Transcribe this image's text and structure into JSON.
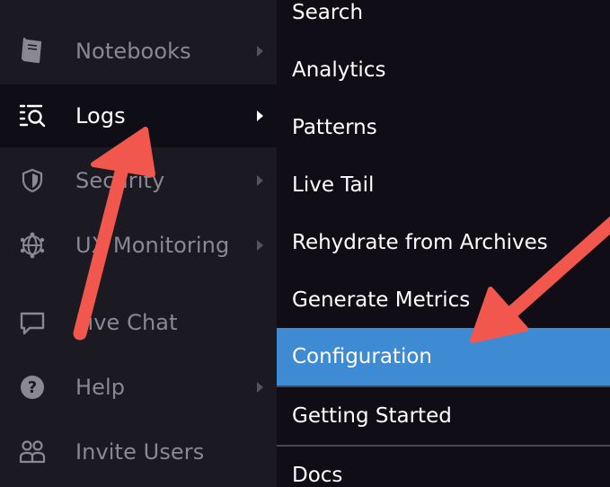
{
  "sidebar": {
    "items": [
      {
        "label": "Notebooks",
        "icon": "notebook-icon"
      },
      {
        "label": "Logs",
        "icon": "logs-icon",
        "active": true
      },
      {
        "label": "Security",
        "icon": "shield-icon"
      },
      {
        "label": "UX Monitoring",
        "icon": "globe-icon"
      },
      {
        "label": "Live Chat",
        "icon": "chat-icon"
      },
      {
        "label": "Help",
        "icon": "help-icon"
      },
      {
        "label": "Invite Users",
        "icon": "users-icon"
      }
    ]
  },
  "submenu": {
    "items": [
      {
        "label": "Search"
      },
      {
        "label": "Analytics"
      },
      {
        "label": "Patterns"
      },
      {
        "label": "Live Tail"
      },
      {
        "label": "Rehydrate from Archives"
      },
      {
        "label": "Generate Metrics"
      },
      {
        "label": "Configuration",
        "selected": true
      },
      {
        "label": "Getting Started"
      },
      {
        "label": "Docs"
      }
    ]
  },
  "colors": {
    "sidebar_bg": "#1b1a22",
    "submenu_bg": "#100d16",
    "selected_bg": "#3e8bd4",
    "annotation_arrow": "#f2574d"
  }
}
